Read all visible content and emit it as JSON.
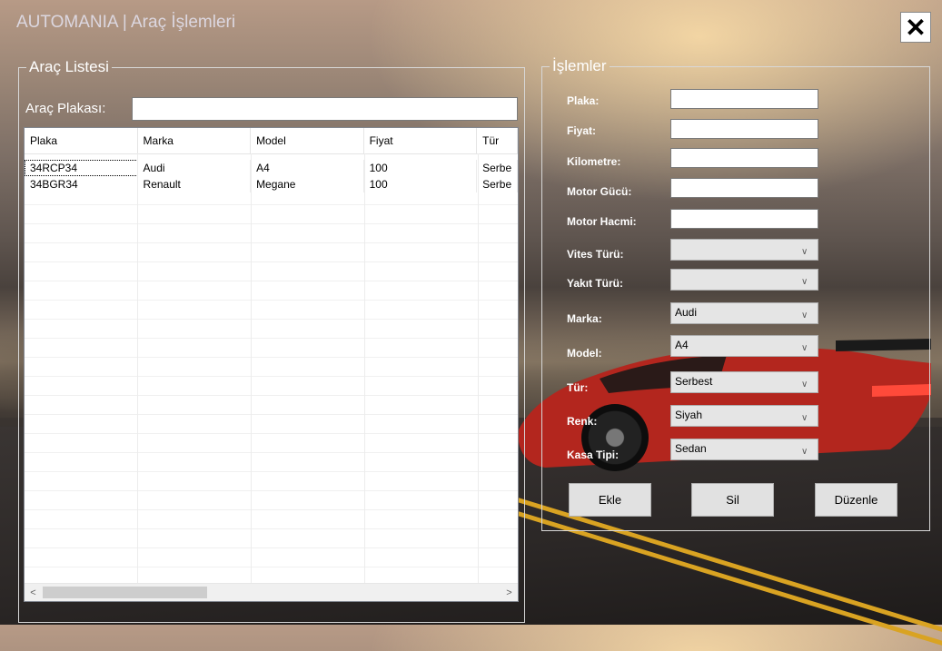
{
  "window": {
    "title": "AUTOMANIA | Araç İşlemleri",
    "close_label": "✕"
  },
  "list_group": {
    "legend": "Araç Listesi",
    "search_label": "Araç Plakası:",
    "search_value": "",
    "columns": [
      "Plaka",
      "Marka",
      "Model",
      "Fiyat",
      "Tür"
    ],
    "rows": [
      [
        "34RCP34",
        "Audi",
        "A4",
        "100",
        "Serbe"
      ],
      [
        "34BGR34",
        "Renault",
        "Megane",
        "100",
        "Serbe"
      ]
    ],
    "scroll_left": "<",
    "scroll_right": ">"
  },
  "ops_group": {
    "legend": "İşlemler",
    "fields": {
      "plaka": {
        "label": "Plaka:",
        "value": ""
      },
      "fiyat": {
        "label": "Fiyat:",
        "value": ""
      },
      "kilometre": {
        "label": "Kilometre:",
        "value": ""
      },
      "motor_gucu": {
        "label": "Motor Gücü:",
        "value": ""
      },
      "motor_hacmi": {
        "label": "Motor Hacmi:",
        "value": ""
      },
      "vites_turu": {
        "label": "Vites Türü:",
        "value": ""
      },
      "yakit_turu": {
        "label": "Yakıt Türü:",
        "value": ""
      },
      "marka": {
        "label": "Marka:",
        "value": "Audi"
      },
      "model": {
        "label": "Model:",
        "value": "A4"
      },
      "tur": {
        "label": "Tür:",
        "value": "Serbest"
      },
      "renk": {
        "label": "Renk:",
        "value": "Siyah"
      },
      "kasa_tipi": {
        "label": "Kasa Tipi:",
        "value": "Sedan"
      }
    },
    "buttons": {
      "add": "Ekle",
      "delete": "Sil",
      "edit": "Düzenle"
    }
  },
  "icons": {
    "dropdown": "chevron-down-icon",
    "close": "close-icon"
  }
}
